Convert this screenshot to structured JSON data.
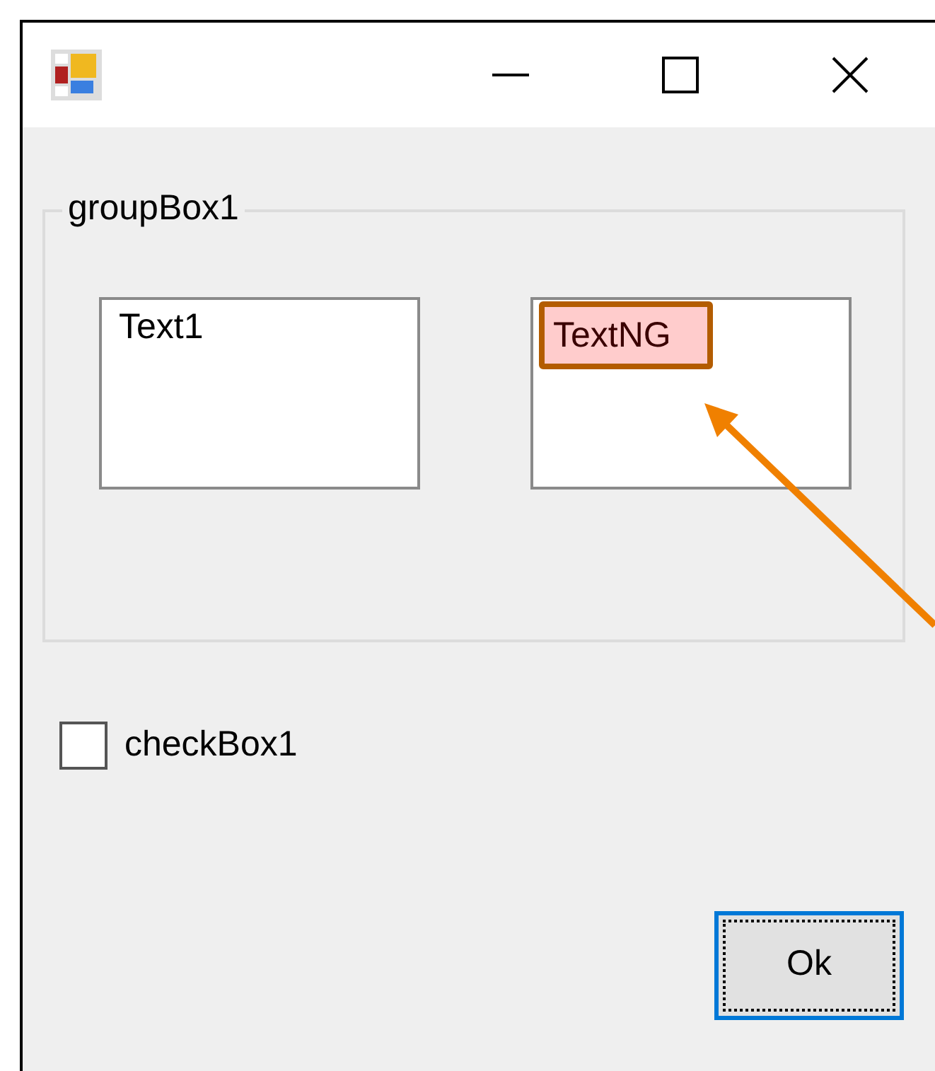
{
  "group_box": {
    "label": "groupBox1",
    "textboxes": [
      {
        "value": "Text1",
        "highlighted": false
      },
      {
        "value": "TextNG",
        "highlighted": true
      }
    ]
  },
  "checkbox": {
    "label": "checkBox1",
    "checked": false
  },
  "ok_button": {
    "label": "Ok",
    "focused": true
  },
  "callout_arrow": true
}
